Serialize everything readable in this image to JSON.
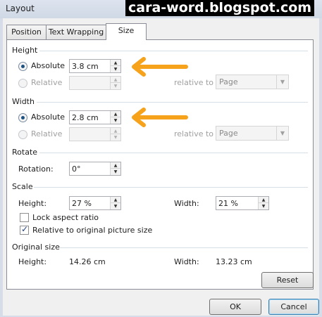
{
  "window": {
    "title": "Layout"
  },
  "watermark": "cara-word.blogspot.com",
  "tabs": [
    "Position",
    "Text Wrapping",
    "Size"
  ],
  "height": {
    "section": "Height",
    "absolute_label": "Absolute",
    "absolute_value": "3.8 cm",
    "relative_label": "Relative",
    "relative_to_label": "relative to",
    "relative_to_value": "Page"
  },
  "width": {
    "section": "Width",
    "absolute_label": "Absolute",
    "absolute_value": "2.8 cm",
    "relative_label": "Relative",
    "relative_to_label": "relative to",
    "relative_to_value": "Page"
  },
  "rotate": {
    "section": "Rotate",
    "label": "Rotation:",
    "value": "0°"
  },
  "scale": {
    "section": "Scale",
    "height_label": "Height:",
    "height_value": "27 %",
    "width_label": "Width:",
    "width_value": "21 %",
    "lock_aspect_label": "Lock aspect ratio",
    "lock_aspect_checked": false,
    "relative_original_label": "Relative to original picture size",
    "relative_original_checked": true
  },
  "original": {
    "section": "Original size",
    "height_label": "Height:",
    "height_value": "14.26 cm",
    "width_label": "Width:",
    "width_value": "13.23 cm"
  },
  "buttons": {
    "reset": "Reset",
    "ok": "OK",
    "cancel": "Cancel"
  },
  "colors": {
    "arrow": "#f7a21b",
    "watermark_bg": "#000000",
    "watermark_fg": "#ffffff"
  }
}
